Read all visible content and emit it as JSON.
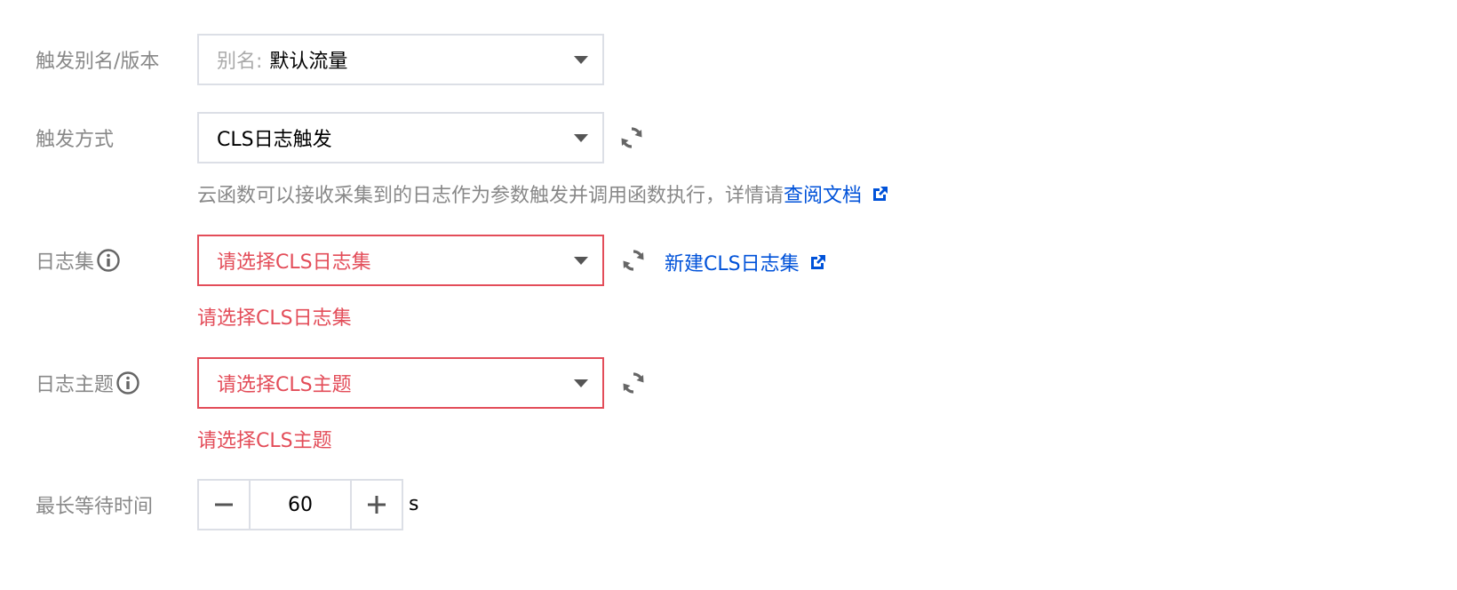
{
  "alias_row": {
    "label": "触发别名/版本",
    "prefix": "别名:",
    "value": "默认流量"
  },
  "trigger_row": {
    "label": "触发方式",
    "value": "CLS日志触发",
    "hint_text": "云函数可以接收采集到的日志作为参数触发并调用函数执行，详情请",
    "hint_link": "查阅文档"
  },
  "logset_row": {
    "label": "日志集",
    "placeholder": "请选择CLS日志集",
    "create_link": "新建CLS日志集",
    "error": "请选择CLS日志集"
  },
  "topic_row": {
    "label": "日志主题",
    "placeholder": "请选择CLS主题",
    "error": "请选择CLS主题"
  },
  "wait_row": {
    "label": "最长等待时间",
    "value": "60",
    "unit": "s"
  },
  "icons": {
    "refresh": "refresh-icon",
    "info": "info-icon",
    "external": "external-link-icon",
    "caret": "chevron-down-icon",
    "minus": "minus-icon",
    "plus": "plus-icon"
  },
  "colors": {
    "error": "#e34d59",
    "link": "#0052d9",
    "label": "#888888",
    "border": "#dcdfe6"
  }
}
